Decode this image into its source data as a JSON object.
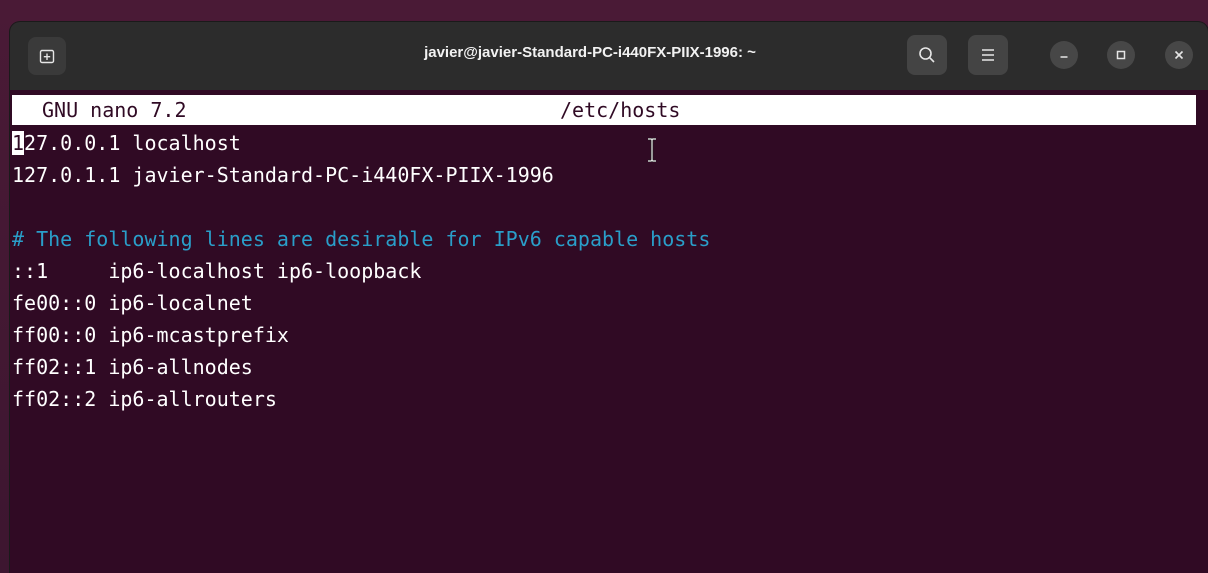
{
  "window": {
    "title": "javier@javier-Standard-PC-i440FX-PIIX-1996: ~"
  },
  "icons": {
    "new_tab": "new-tab-icon",
    "search": "search-icon",
    "menu": "hamburger-menu-icon",
    "minimize": "minimize-icon",
    "maximize": "maximize-icon",
    "close": "close-icon",
    "pointer": "text-cursor-icon"
  },
  "nano": {
    "version": "GNU nano 7.2",
    "filename": "/etc/hosts"
  },
  "file": {
    "line1_cursor": "1",
    "line1_rest": "27.0.0.1 localhost",
    "line2": "127.0.1.1 javier-Standard-PC-i440FX-PIIX-1996",
    "comment": "# The following lines are desirable for IPv6 capable hosts",
    "line4": "::1     ip6-localhost ip6-loopback",
    "line5": "fe00::0 ip6-localnet",
    "line6": "ff00::0 ip6-mcastprefix",
    "line7": "ff02::1 ip6-allnodes",
    "line8": "ff02::2 ip6-allrouters"
  },
  "colors": {
    "terminal_bg": "#300a24",
    "comment": "#2a9ec9",
    "headerbar": "#2c2c2c"
  }
}
